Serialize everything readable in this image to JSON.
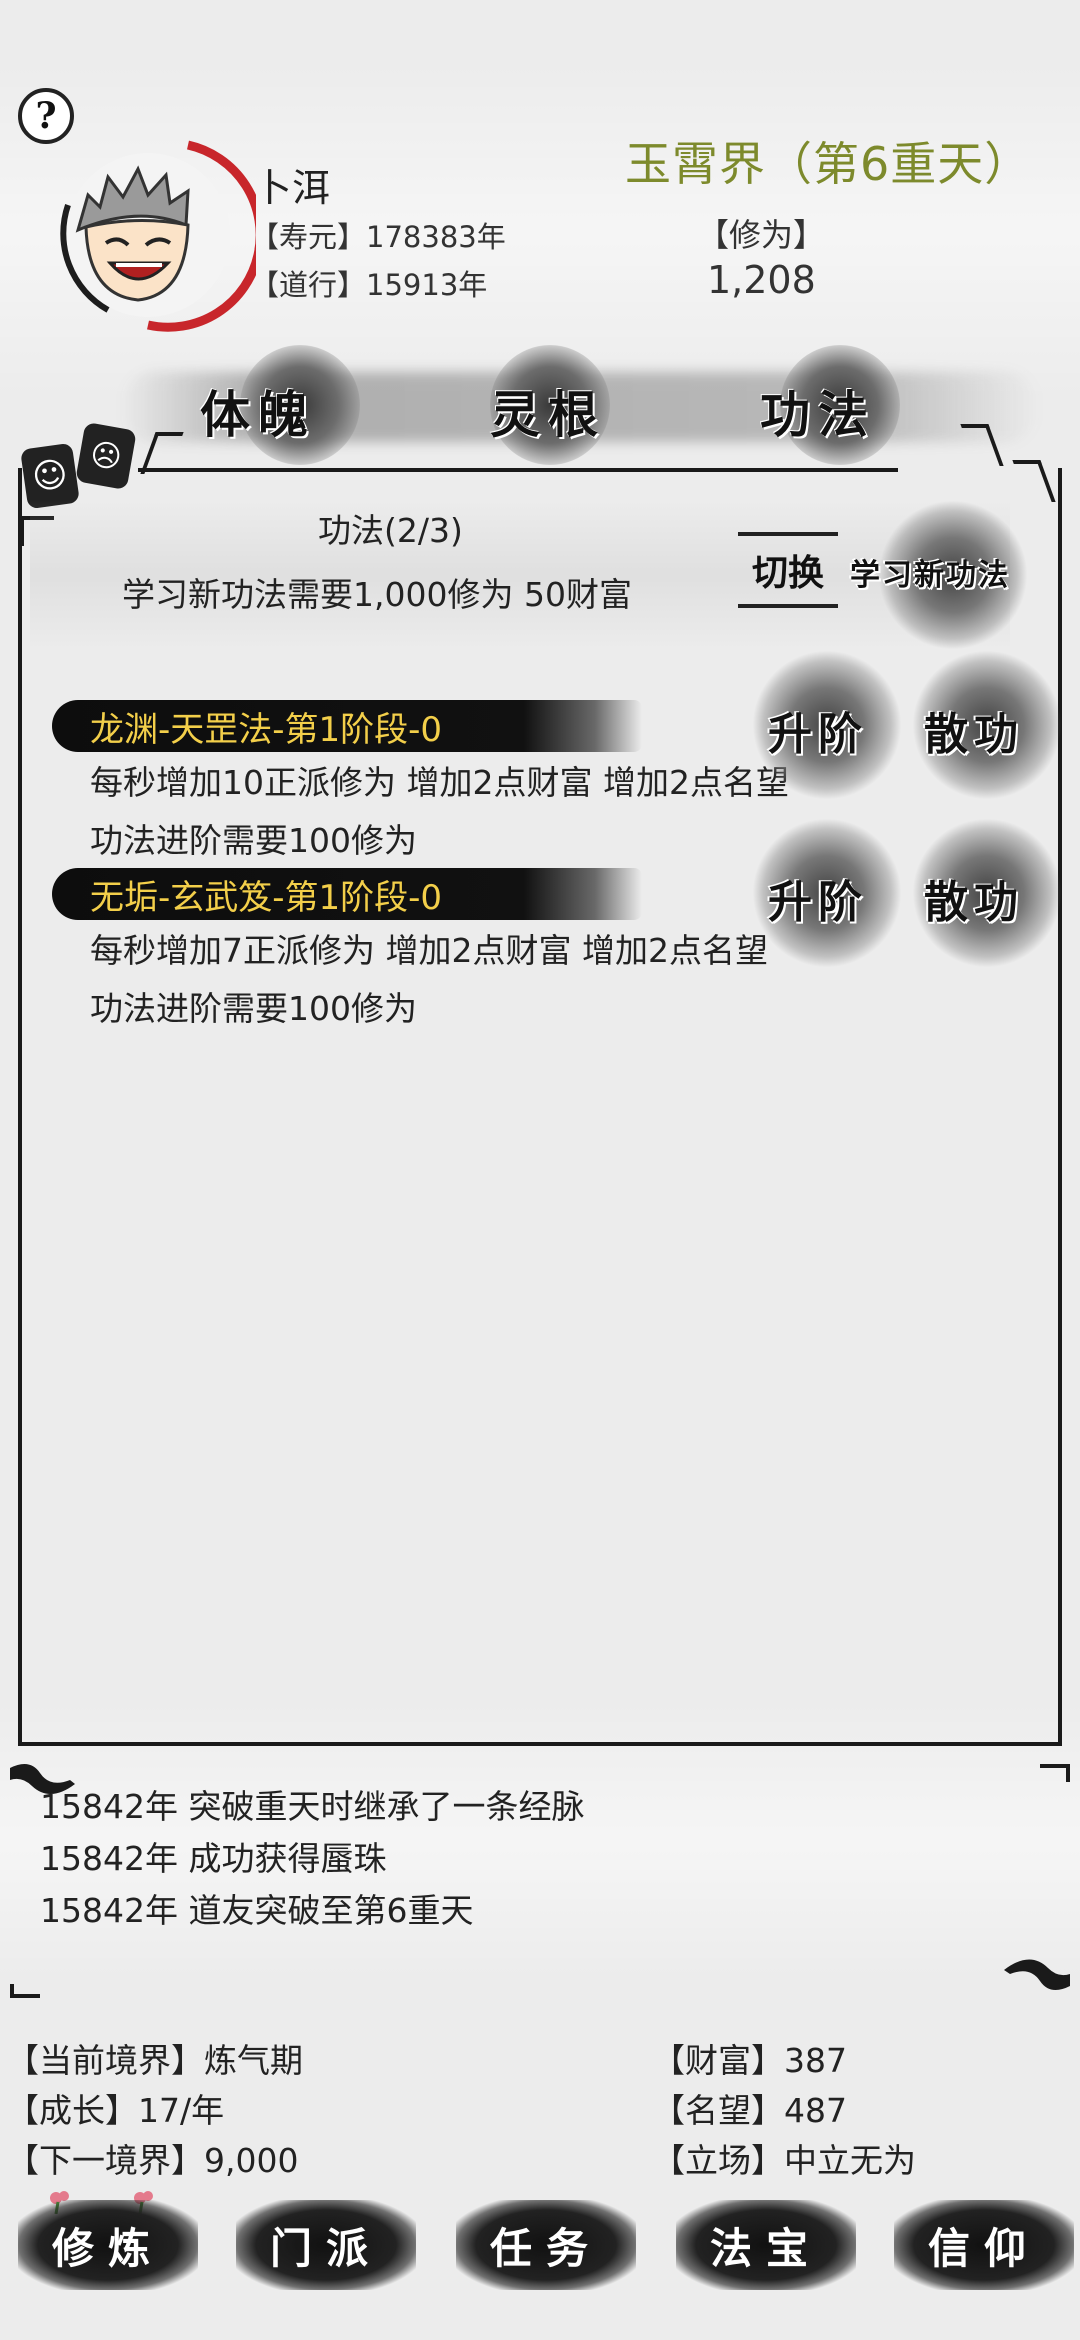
{
  "header": {
    "help_icon": "?",
    "player_name": "卜洱",
    "lifespan_label": "【寿元】",
    "lifespan_value": "178383年",
    "dao_label": "【道行】",
    "dao_value": "15913年",
    "realm_title": "玉霄界（第6重天）",
    "cultivation_label": "【修为】",
    "cultivation_value": "1,208"
  },
  "top_tabs": [
    {
      "label": "体魄"
    },
    {
      "label": "灵根"
    },
    {
      "label": "功法"
    }
  ],
  "emotion_buttons": [
    "happy-face-icon",
    "angry-face-icon"
  ],
  "panel": {
    "title": "功法(2/3)",
    "learn_requirement": "学习新功法需要1,000修为 50财富",
    "switch_label": "切换",
    "learn_new_label": "学习新功法",
    "skills": [
      {
        "name": "龙渊-天罡法-第1阶段-0",
        "effect": "每秒增加10正派修为 增加2点财富 增加2点名望",
        "advance_req": "功法进阶需要100修为",
        "upgrade_label": "升阶",
        "dismiss_label": "散功"
      },
      {
        "name": "无垢-玄武笈-第1阶段-0",
        "effect": "每秒增加7正派修为 增加2点财富 增加2点名望",
        "advance_req": "功法进阶需要100修为",
        "upgrade_label": "升阶",
        "dismiss_label": "散功"
      }
    ]
  },
  "log": [
    "15842年 突破重天时继承了一条经脉",
    "15842年 成功获得蜃珠",
    "15842年 道友突破至第6重天"
  ],
  "stats": {
    "realm_label": "【当前境界】",
    "realm_value": "炼气期",
    "growth_label": "【成长】",
    "growth_value": "17/年",
    "next_label": "【下一境界】",
    "next_value": "9,000",
    "wealth_label": "【财富】",
    "wealth_value": "387",
    "fame_label": "【名望】",
    "fame_value": "487",
    "stance_label": "【立场】",
    "stance_value": "中立无为"
  },
  "bottom_nav": [
    {
      "label": "修炼"
    },
    {
      "label": "门派"
    },
    {
      "label": "任务"
    },
    {
      "label": "法宝"
    },
    {
      "label": "信仰"
    }
  ],
  "colors": {
    "realm_title": "#7d8a2c",
    "skill_name": "#f3cf4a",
    "avatar_ring": "#c8262b"
  }
}
